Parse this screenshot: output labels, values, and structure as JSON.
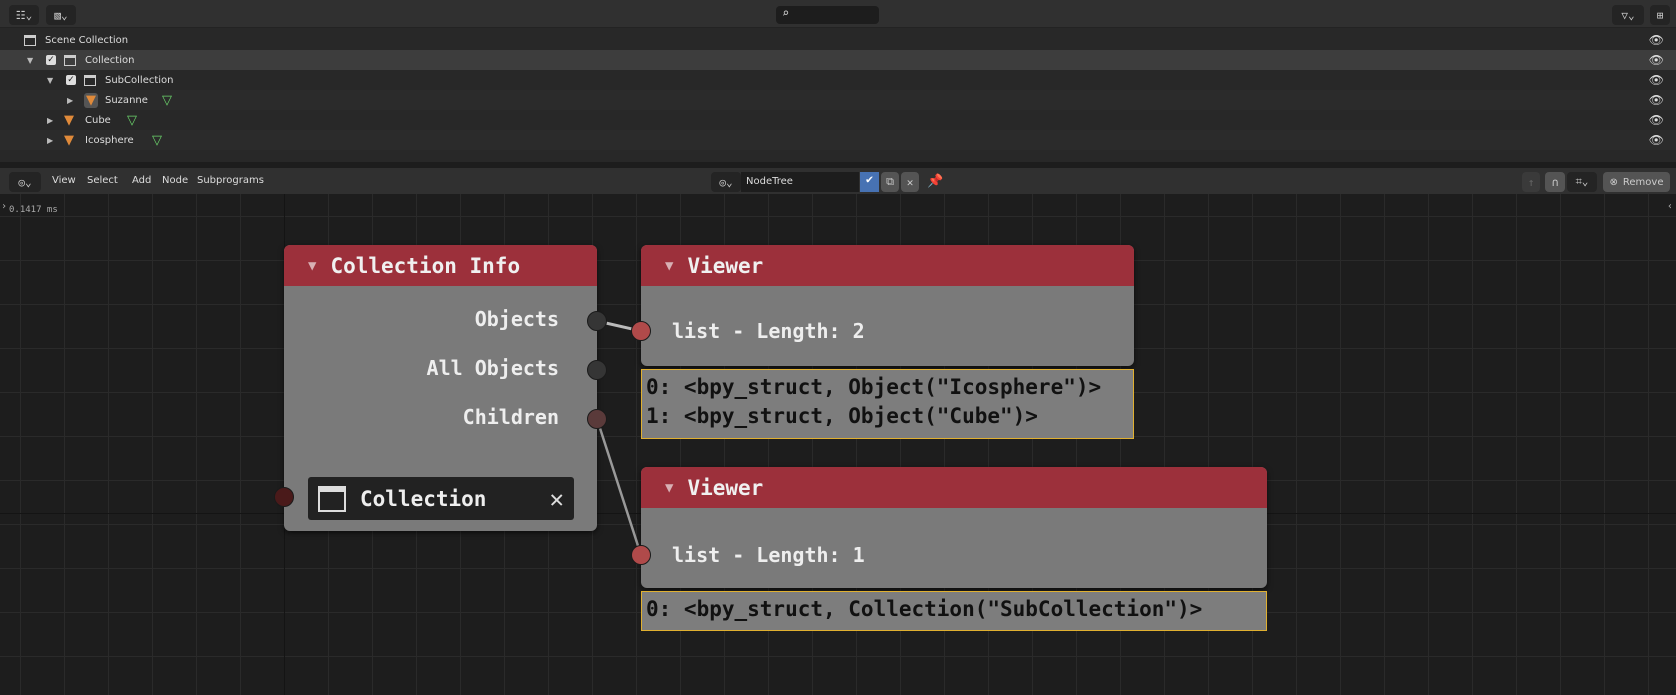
{
  "outliner": {
    "header_buttons": [
      "display-mode",
      "filter-view"
    ],
    "items": [
      {
        "label": "Scene Collection",
        "type": "scene-collection"
      },
      {
        "label": "Collection",
        "type": "collection",
        "checked": true,
        "selected": true
      },
      {
        "label": "SubCollection",
        "type": "collection",
        "checked": true
      },
      {
        "label": "Suzanne",
        "type": "mesh-object"
      },
      {
        "label": "Cube",
        "type": "mesh-object"
      },
      {
        "label": "Icosphere",
        "type": "mesh-object"
      }
    ]
  },
  "node_header": {
    "menus": [
      "View",
      "Select",
      "Add",
      "Node",
      "Subprograms"
    ],
    "tree_name": "NodeTree",
    "remove_label": "Remove"
  },
  "editor": {
    "timing": "0.1417 ms",
    "nodes": {
      "collection_info": {
        "title": "Collection Info",
        "outputs": [
          "Objects",
          "All Objects",
          "Children"
        ],
        "collection_field": "Collection"
      },
      "viewer1": {
        "title": "Viewer",
        "value": "list - Length: 2",
        "output": "0: <bpy_struct, Object(\"Icosphere\")>\n1: <bpy_struct, Object(\"Cube\")>"
      },
      "viewer2": {
        "title": "Viewer",
        "value": "list - Length: 1",
        "output": "0: <bpy_struct, Collection(\"SubCollection\")>"
      }
    }
  },
  "colors": {
    "node_header": "#9c303b",
    "node_body": "#7a7a7a",
    "output_border": "#e0b030",
    "socket_list": "#b04a4a"
  }
}
